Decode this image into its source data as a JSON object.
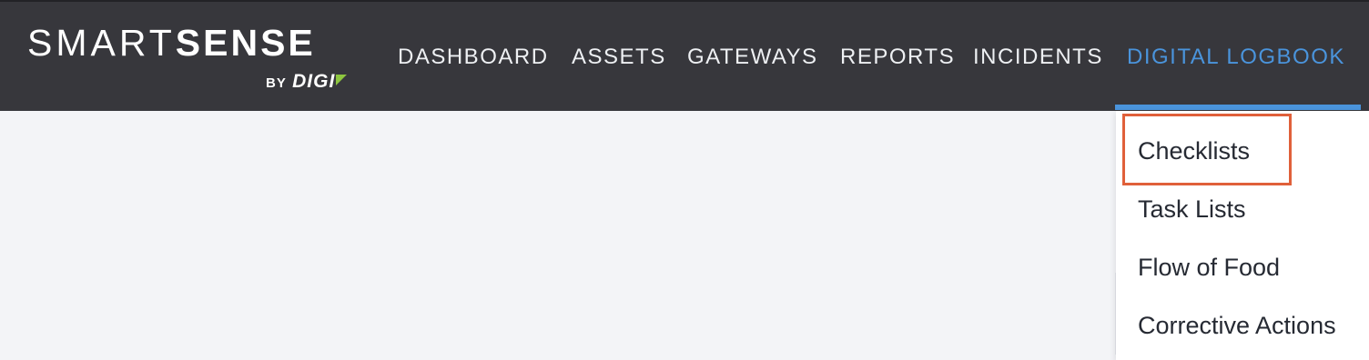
{
  "logo": {
    "word_light": "SMART",
    "word_bold": "SENSE",
    "by": "BY",
    "digi": "DIGI"
  },
  "nav": {
    "items": [
      {
        "label": "DASHBOARD",
        "active": false
      },
      {
        "label": "ASSETS",
        "active": false
      },
      {
        "label": "GATEWAYS",
        "active": false
      },
      {
        "label": "REPORTS",
        "active": false
      },
      {
        "label": "INCIDENTS",
        "active": false
      },
      {
        "label": "DIGITAL LOGBOOK",
        "active": true
      }
    ]
  },
  "dropdown": {
    "items": [
      {
        "label": "Checklists",
        "highlighted": true
      },
      {
        "label": "Task Lists",
        "highlighted": false
      },
      {
        "label": "Flow of Food",
        "highlighted": false
      },
      {
        "label": "Corrective Actions",
        "highlighted": false
      }
    ]
  },
  "colors": {
    "topbar_bg": "#37373c",
    "accent_blue": "#4a94dc",
    "highlight_orange": "#e0603a",
    "page_bg": "#f3f4f7",
    "logo_mark_green": "#8dc63f"
  }
}
